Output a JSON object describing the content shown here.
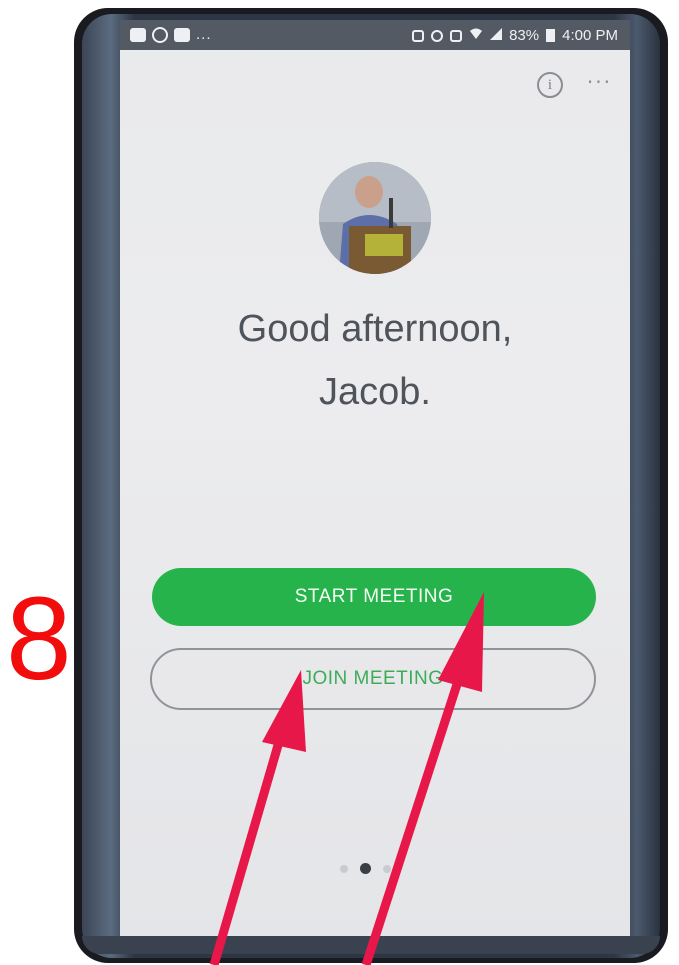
{
  "step_number": "8",
  "status_bar": {
    "left_more": "...",
    "battery": "83%",
    "time": "4:00 PM"
  },
  "toolbar": {
    "info_icon": "i",
    "more_icon": "···"
  },
  "greeting": {
    "line1": "Good afternoon,",
    "line2": "Jacob."
  },
  "buttons": {
    "start_meeting": "START MEETING",
    "join_meeting": "JOIN MEETING"
  },
  "pager": {
    "pages": 3,
    "active_index": 1
  },
  "colors": {
    "accent_green": "#27b34c",
    "annotation_red": "#f20c0c",
    "arrow_red": "#e8174a"
  },
  "icons": [
    "youtube-icon",
    "whatsapp-icon",
    "youtube-icon",
    "alarm-icon",
    "sync-icon",
    "nfc-icon",
    "wifi-icon",
    "signal-icon",
    "battery-icon",
    "info-icon",
    "more-icon"
  ]
}
